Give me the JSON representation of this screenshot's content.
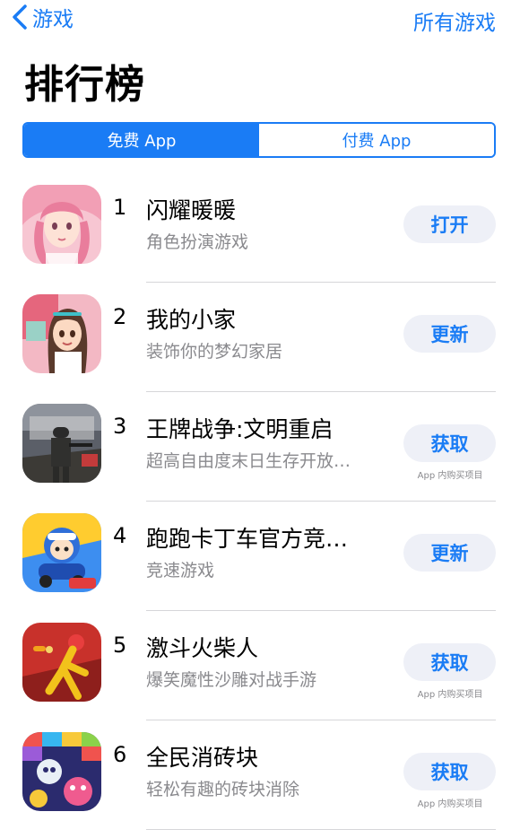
{
  "nav": {
    "back_label": "游戏",
    "right_label": "所有游戏"
  },
  "title": "排行榜",
  "segments": [
    {
      "label": "免费 App",
      "active": true
    },
    {
      "label": "付费 App",
      "active": false
    }
  ],
  "apps": [
    {
      "rank": "1",
      "name": "闪耀暖暖",
      "subtitle": "角色扮演游戏",
      "button": "打开",
      "iap": "",
      "icon": "girl-portrait-icon"
    },
    {
      "rank": "2",
      "name": "我的小家",
      "subtitle": "装饰你的梦幻家居",
      "button": "更新",
      "iap": "",
      "icon": "cartoon-girl-icon"
    },
    {
      "rank": "3",
      "name": "王牌战争:文明重启",
      "subtitle": "超高自由度末日生存开放…",
      "button": "获取",
      "iap": "App 内购买项目",
      "icon": "15-days-survivor-icon"
    },
    {
      "rank": "4",
      "name": "跑跑卡丁车官方竞…",
      "subtitle": "竞速游戏",
      "button": "更新",
      "iap": "",
      "icon": "kart-racer-icon"
    },
    {
      "rank": "5",
      "name": "激斗火柴人",
      "subtitle": "爆笑魔性沙雕对战手游",
      "button": "获取",
      "iap": "App 内购买项目",
      "icon": "stickman-fighter-icon"
    },
    {
      "rank": "6",
      "name": "全民消砖块",
      "subtitle": "轻松有趣的砖块消除",
      "button": "获取",
      "iap": "App 内购买项目",
      "icon": "brick-breaker-icon"
    }
  ],
  "colors": {
    "accent": "#1a7cf5",
    "button_bg": "#eef0f7",
    "secondary_text": "#8a8a8e"
  }
}
